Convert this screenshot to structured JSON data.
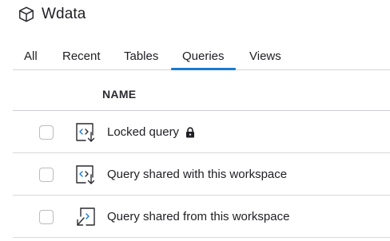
{
  "header": {
    "title": "Wdata",
    "icon": "cube-icon"
  },
  "tabs": [
    {
      "label": "All",
      "active": false
    },
    {
      "label": "Recent",
      "active": false
    },
    {
      "label": "Tables",
      "active": false
    },
    {
      "label": "Queries",
      "active": true
    },
    {
      "label": "Views",
      "active": false
    }
  ],
  "table": {
    "column_name": "NAME",
    "rows": [
      {
        "label": "Locked query",
        "icon": "query-locked-icon",
        "locked": true
      },
      {
        "label": "Query shared with this workspace",
        "icon": "query-shared-with-icon",
        "locked": false
      },
      {
        "label": "Query shared from this workspace",
        "icon": "query-shared-from-icon",
        "locked": false
      }
    ]
  },
  "colors": {
    "accent": "#1a7ad2",
    "text": "#1f1f24",
    "divider": "#d4d4d8"
  }
}
